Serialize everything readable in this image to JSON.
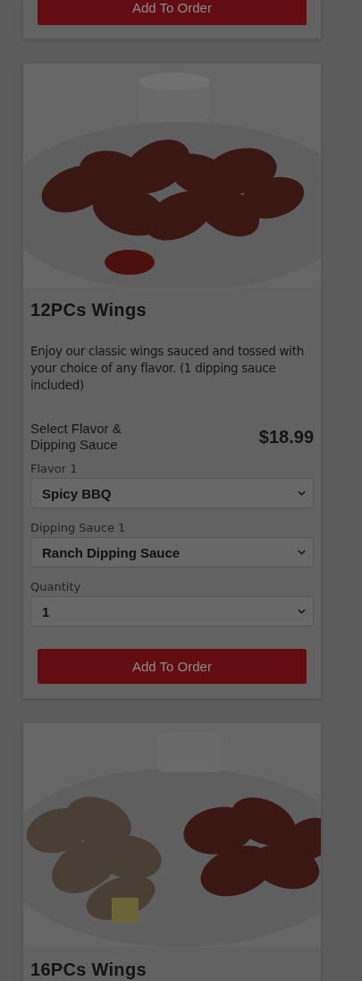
{
  "items": [
    {
      "kind": "partial",
      "button_label": "Add To Order"
    },
    {
      "kind": "full",
      "title": "12PCs Wings",
      "description": "Enjoy our classic wings sauced and tossed with your choice of any flavor. (1 dipping sauce included)",
      "price_label": "Select Flavor & Dipping Sauce",
      "price": "$18.99",
      "fields": [
        {
          "label": "Flavor 1",
          "value": "Spicy BBQ"
        },
        {
          "label": "Dipping Sauce 1",
          "value": "Ranch Dipping Sauce"
        },
        {
          "label": "Quantity",
          "value": "1"
        }
      ],
      "button_label": "Add To Order"
    },
    {
      "kind": "cut",
      "title": "16PCs Wings"
    }
  ]
}
